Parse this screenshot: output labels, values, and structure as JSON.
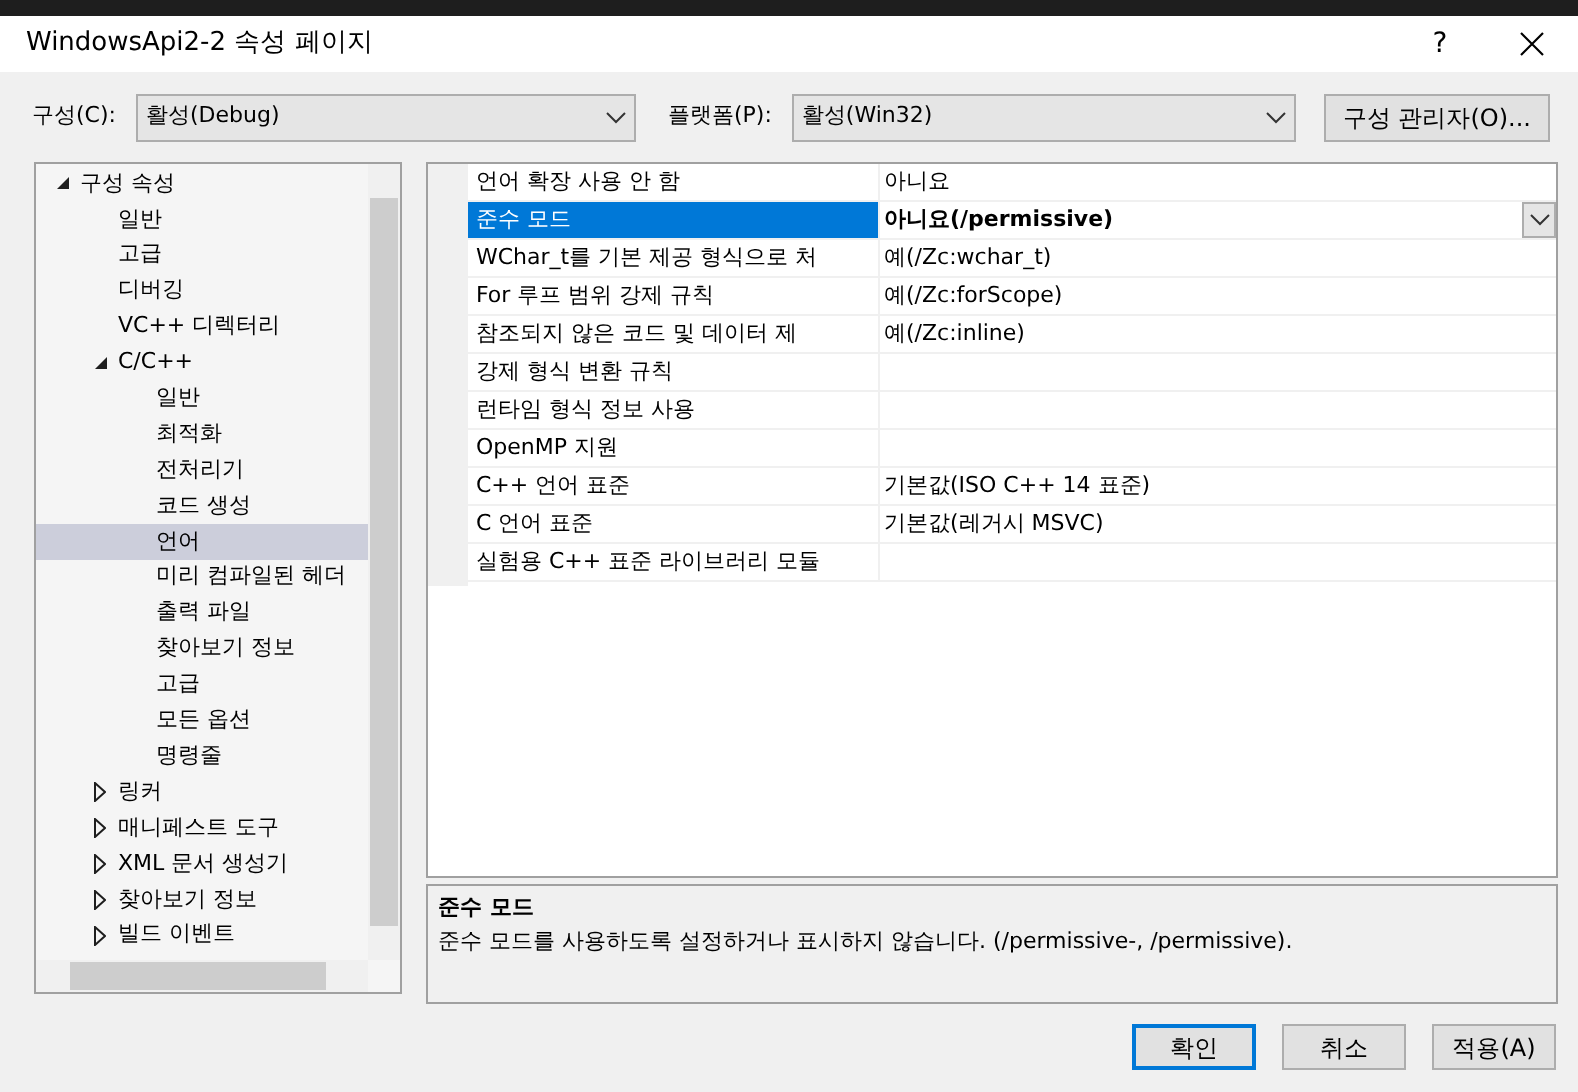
{
  "window": {
    "title": "WindowsApi2-2 속성 페이지",
    "help_button": "?"
  },
  "toolbar": {
    "configuration": {
      "label": "구성(C):",
      "value": "활성(Debug)"
    },
    "platform": {
      "label": "플랫폼(P):",
      "value": "활성(Win32)"
    },
    "manager_button": "구성 관리자(O)..."
  },
  "tree": [
    {
      "label": "구성 속성",
      "selected": false,
      "expanded": true,
      "children": [
        {
          "label": "일반",
          "selected": false
        },
        {
          "label": "고급",
          "selected": false
        },
        {
          "label": "디버깅",
          "selected": false
        },
        {
          "label": "VC++ 디렉터리",
          "selected": false
        },
        {
          "label": "C/C++",
          "selected": false,
          "expanded": true,
          "children": [
            {
              "label": "일반",
              "selected": false
            },
            {
              "label": "최적화",
              "selected": false
            },
            {
              "label": "전처리기",
              "selected": false
            },
            {
              "label": "코드 생성",
              "selected": false
            },
            {
              "label": "언어",
              "selected": true
            },
            {
              "label": "미리 컴파일된 헤더",
              "selected": false
            },
            {
              "label": "출력 파일",
              "selected": false
            },
            {
              "label": "찾아보기 정보",
              "selected": false
            },
            {
              "label": "고급",
              "selected": false
            },
            {
              "label": "모든 옵션",
              "selected": false
            },
            {
              "label": "명령줄",
              "selected": false
            }
          ]
        },
        {
          "label": "링커",
          "selected": false,
          "expanded": false
        },
        {
          "label": "매니페스트 도구",
          "selected": false,
          "expanded": false
        },
        {
          "label": "XML 문서 생성기",
          "selected": false,
          "expanded": false
        },
        {
          "label": "찾아보기 정보",
          "selected": false,
          "expanded": false
        },
        {
          "label": "빌드 이벤트",
          "selected": false,
          "expanded": false
        }
      ]
    }
  ],
  "properties": [
    {
      "name": "언어 확장 사용 안 함",
      "value": "아니요",
      "selected": false
    },
    {
      "name": "준수 모드",
      "value": "아니요(/permissive)",
      "selected": true
    },
    {
      "name": "WChar_t를 기본 제공 형식으로 처",
      "value": "예(/Zc:wchar_t)",
      "selected": false
    },
    {
      "name": "For 루프 범위 강제 규칙",
      "value": "예(/Zc:forScope)",
      "selected": false
    },
    {
      "name": "참조되지 않은 코드 및 데이터 제",
      "value": "예(/Zc:inline)",
      "selected": false
    },
    {
      "name": "강제 형식 변환 규칙",
      "selected": false
    },
    {
      "name": "런타임 형식 정보 사용",
      "selected": false
    },
    {
      "name": "OpenMP 지원",
      "selected": false
    },
    {
      "name": "C++ 언어 표준",
      "value": "기본값(ISO C++ 14 표준)",
      "selected": false
    },
    {
      "name": "C 언어 표준",
      "value": "기본값(레거시 MSVC)",
      "selected": false
    },
    {
      "name": "실험용 C++ 표준 라이브러리 모듈",
      "selected": false
    }
  ],
  "description": {
    "title": "준수 모드",
    "text": "준수 모드를 사용하도록 설정하거나 표시하지 않습니다. (/permissive-, /permissive)."
  },
  "buttons": [
    {
      "label": "확인",
      "default": true
    },
    {
      "label": "취소",
      "default": false
    },
    {
      "label": "적용(A)",
      "default": false
    }
  ]
}
